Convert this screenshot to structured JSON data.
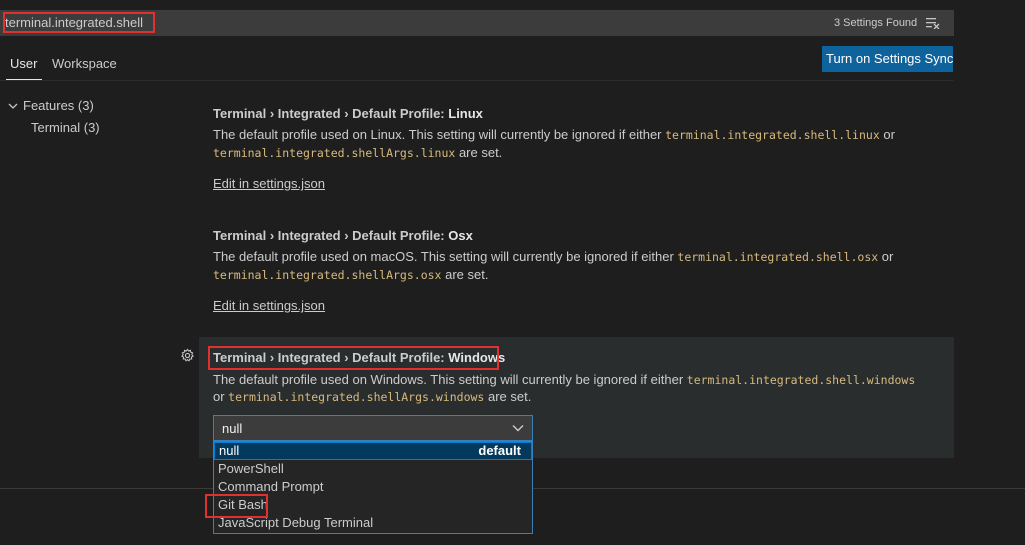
{
  "search": {
    "query": "terminal.integrated.shell",
    "results_count": "3 Settings Found"
  },
  "tabs": [
    {
      "label": "User",
      "active": true
    },
    {
      "label": "Workspace",
      "active": false
    }
  ],
  "sync_button": "Turn on Settings Sync",
  "toc": {
    "features": "Features (3)",
    "terminal": "Terminal (3)"
  },
  "settings": [
    {
      "category": "Terminal › Integrated › ",
      "key": "Default Profile: ",
      "os": "Linux",
      "desc_prefix": "The default profile used on Linux. This setting will currently be ignored if either ",
      "code1": "terminal.integrated.shell.linux",
      "mid": " or",
      "code2": "terminal.integrated.shellArgs.linux",
      "suffix": " are set.",
      "link": "Edit in settings.json"
    },
    {
      "category": "Terminal › Integrated › ",
      "key": "Default Profile: ",
      "os": "Osx",
      "desc_prefix": "The default profile used on macOS. This setting will currently be ignored if either ",
      "code1": "terminal.integrated.shell.osx",
      "mid": " or",
      "code2": "terminal.integrated.shellArgs.osx",
      "suffix": " are set.",
      "link": "Edit in settings.json"
    },
    {
      "category": "Terminal › Integrated › ",
      "key": "Default Profile: ",
      "os": "Windows",
      "desc_prefix": "The default profile used on Windows. This setting will currently be ignored if either ",
      "code1": "terminal.integrated.shell.windows",
      "line2_prefix": "or ",
      "code2": "terminal.integrated.shellArgs.windows",
      "suffix": " are set.",
      "select_value": "null",
      "options": [
        {
          "label": "null",
          "tag": "default"
        },
        {
          "label": "PowerShell"
        },
        {
          "label": "Command Prompt"
        },
        {
          "label": "Git Bash"
        },
        {
          "label": "JavaScript Debug Terminal"
        }
      ]
    }
  ],
  "colors": {
    "accent": "#0e639c",
    "highlight_box": "#e03131",
    "code": "#d7ba7d"
  }
}
